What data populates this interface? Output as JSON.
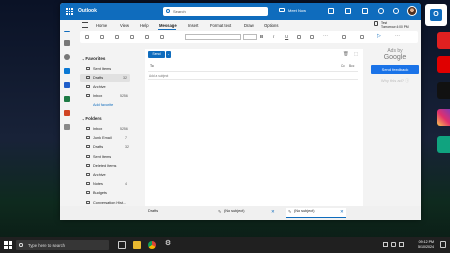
{
  "window": {
    "app_name": "Outlook",
    "search_placeholder": "Search",
    "meet_now": "Meet Now",
    "reminder_line1": "Test",
    "reminder_line2": "Tomorrow 4:00 PM"
  },
  "menu": [
    "Home",
    "View",
    "Help",
    "Message",
    "Insert",
    "Format text",
    "Draw",
    "Options"
  ],
  "menu_active": "Message",
  "favorites": {
    "header": "Favorites",
    "items": [
      {
        "label": "Sent Items",
        "count": ""
      },
      {
        "label": "Drafts",
        "count": "32"
      },
      {
        "label": "Archive",
        "count": ""
      },
      {
        "label": "Inbox",
        "count": "5256"
      }
    ],
    "add_favorite": "Add favorite"
  },
  "folders": {
    "header": "Folders",
    "items": [
      {
        "label": "Inbox",
        "count": "5256"
      },
      {
        "label": "Junk Email",
        "count": "7"
      },
      {
        "label": "Drafts",
        "count": "32"
      },
      {
        "label": "Sent Items",
        "count": ""
      },
      {
        "label": "Deleted Items",
        "count": ""
      },
      {
        "label": "Archive",
        "count": ""
      },
      {
        "label": "Notes",
        "count": "4"
      },
      {
        "label": "Budgets",
        "count": ""
      },
      {
        "label": "Conversation Hist...",
        "count": ""
      },
      {
        "label": "Documents",
        "count": ""
      },
      {
        "label": "Webinar",
        "count": ""
      }
    ]
  },
  "compose": {
    "send_label": "Send",
    "to_label": "To",
    "cc_label": "Cc",
    "bcc_label": "Bcc",
    "subject_placeholder": "Add a subject"
  },
  "ad": {
    "ads_by": "Ads by",
    "google": "Google",
    "send_feedback": "Send feedback",
    "why_ad": "Why this ad? ⓘ"
  },
  "bottom_tabs": {
    "drafts": "Drafts",
    "tab1": "(No subject)",
    "tab2": "(No subject)"
  },
  "taskbar": {
    "search_placeholder": "Type here to search",
    "time": "09:12 PM",
    "date": "5/10/2024"
  },
  "colors": {
    "brand": "#0f6cbd",
    "ad_button": "#1a73e8",
    "taskbar": "#202020"
  }
}
